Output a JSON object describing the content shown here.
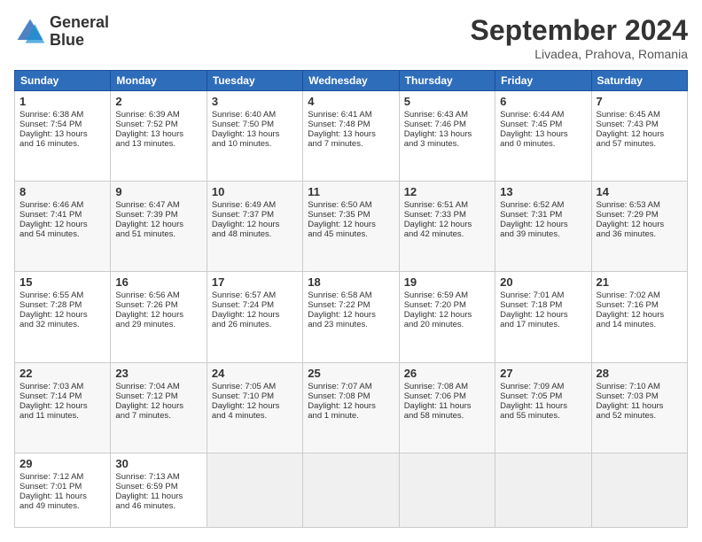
{
  "header": {
    "logo_line1": "General",
    "logo_line2": "Blue",
    "month": "September 2024",
    "location": "Livadea, Prahova, Romania"
  },
  "days_of_week": [
    "Sunday",
    "Monday",
    "Tuesday",
    "Wednesday",
    "Thursday",
    "Friday",
    "Saturday"
  ],
  "weeks": [
    [
      {
        "day": "1",
        "info": "Sunrise: 6:38 AM\nSunset: 7:54 PM\nDaylight: 13 hours\nand 16 minutes."
      },
      {
        "day": "2",
        "info": "Sunrise: 6:39 AM\nSunset: 7:52 PM\nDaylight: 13 hours\nand 13 minutes."
      },
      {
        "day": "3",
        "info": "Sunrise: 6:40 AM\nSunset: 7:50 PM\nDaylight: 13 hours\nand 10 minutes."
      },
      {
        "day": "4",
        "info": "Sunrise: 6:41 AM\nSunset: 7:48 PM\nDaylight: 13 hours\nand 7 minutes."
      },
      {
        "day": "5",
        "info": "Sunrise: 6:43 AM\nSunset: 7:46 PM\nDaylight: 13 hours\nand 3 minutes."
      },
      {
        "day": "6",
        "info": "Sunrise: 6:44 AM\nSunset: 7:45 PM\nDaylight: 13 hours\nand 0 minutes."
      },
      {
        "day": "7",
        "info": "Sunrise: 6:45 AM\nSunset: 7:43 PM\nDaylight: 12 hours\nand 57 minutes."
      }
    ],
    [
      {
        "day": "8",
        "info": "Sunrise: 6:46 AM\nSunset: 7:41 PM\nDaylight: 12 hours\nand 54 minutes."
      },
      {
        "day": "9",
        "info": "Sunrise: 6:47 AM\nSunset: 7:39 PM\nDaylight: 12 hours\nand 51 minutes."
      },
      {
        "day": "10",
        "info": "Sunrise: 6:49 AM\nSunset: 7:37 PM\nDaylight: 12 hours\nand 48 minutes."
      },
      {
        "day": "11",
        "info": "Sunrise: 6:50 AM\nSunset: 7:35 PM\nDaylight: 12 hours\nand 45 minutes."
      },
      {
        "day": "12",
        "info": "Sunrise: 6:51 AM\nSunset: 7:33 PM\nDaylight: 12 hours\nand 42 minutes."
      },
      {
        "day": "13",
        "info": "Sunrise: 6:52 AM\nSunset: 7:31 PM\nDaylight: 12 hours\nand 39 minutes."
      },
      {
        "day": "14",
        "info": "Sunrise: 6:53 AM\nSunset: 7:29 PM\nDaylight: 12 hours\nand 36 minutes."
      }
    ],
    [
      {
        "day": "15",
        "info": "Sunrise: 6:55 AM\nSunset: 7:28 PM\nDaylight: 12 hours\nand 32 minutes."
      },
      {
        "day": "16",
        "info": "Sunrise: 6:56 AM\nSunset: 7:26 PM\nDaylight: 12 hours\nand 29 minutes."
      },
      {
        "day": "17",
        "info": "Sunrise: 6:57 AM\nSunset: 7:24 PM\nDaylight: 12 hours\nand 26 minutes."
      },
      {
        "day": "18",
        "info": "Sunrise: 6:58 AM\nSunset: 7:22 PM\nDaylight: 12 hours\nand 23 minutes."
      },
      {
        "day": "19",
        "info": "Sunrise: 6:59 AM\nSunset: 7:20 PM\nDaylight: 12 hours\nand 20 minutes."
      },
      {
        "day": "20",
        "info": "Sunrise: 7:01 AM\nSunset: 7:18 PM\nDaylight: 12 hours\nand 17 minutes."
      },
      {
        "day": "21",
        "info": "Sunrise: 7:02 AM\nSunset: 7:16 PM\nDaylight: 12 hours\nand 14 minutes."
      }
    ],
    [
      {
        "day": "22",
        "info": "Sunrise: 7:03 AM\nSunset: 7:14 PM\nDaylight: 12 hours\nand 11 minutes."
      },
      {
        "day": "23",
        "info": "Sunrise: 7:04 AM\nSunset: 7:12 PM\nDaylight: 12 hours\nand 7 minutes."
      },
      {
        "day": "24",
        "info": "Sunrise: 7:05 AM\nSunset: 7:10 PM\nDaylight: 12 hours\nand 4 minutes."
      },
      {
        "day": "25",
        "info": "Sunrise: 7:07 AM\nSunset: 7:08 PM\nDaylight: 12 hours\nand 1 minute."
      },
      {
        "day": "26",
        "info": "Sunrise: 7:08 AM\nSunset: 7:06 PM\nDaylight: 11 hours\nand 58 minutes."
      },
      {
        "day": "27",
        "info": "Sunrise: 7:09 AM\nSunset: 7:05 PM\nDaylight: 11 hours\nand 55 minutes."
      },
      {
        "day": "28",
        "info": "Sunrise: 7:10 AM\nSunset: 7:03 PM\nDaylight: 11 hours\nand 52 minutes."
      }
    ],
    [
      {
        "day": "29",
        "info": "Sunrise: 7:12 AM\nSunset: 7:01 PM\nDaylight: 11 hours\nand 49 minutes."
      },
      {
        "day": "30",
        "info": "Sunrise: 7:13 AM\nSunset: 6:59 PM\nDaylight: 11 hours\nand 46 minutes."
      },
      {
        "day": "",
        "info": ""
      },
      {
        "day": "",
        "info": ""
      },
      {
        "day": "",
        "info": ""
      },
      {
        "day": "",
        "info": ""
      },
      {
        "day": "",
        "info": ""
      }
    ]
  ]
}
